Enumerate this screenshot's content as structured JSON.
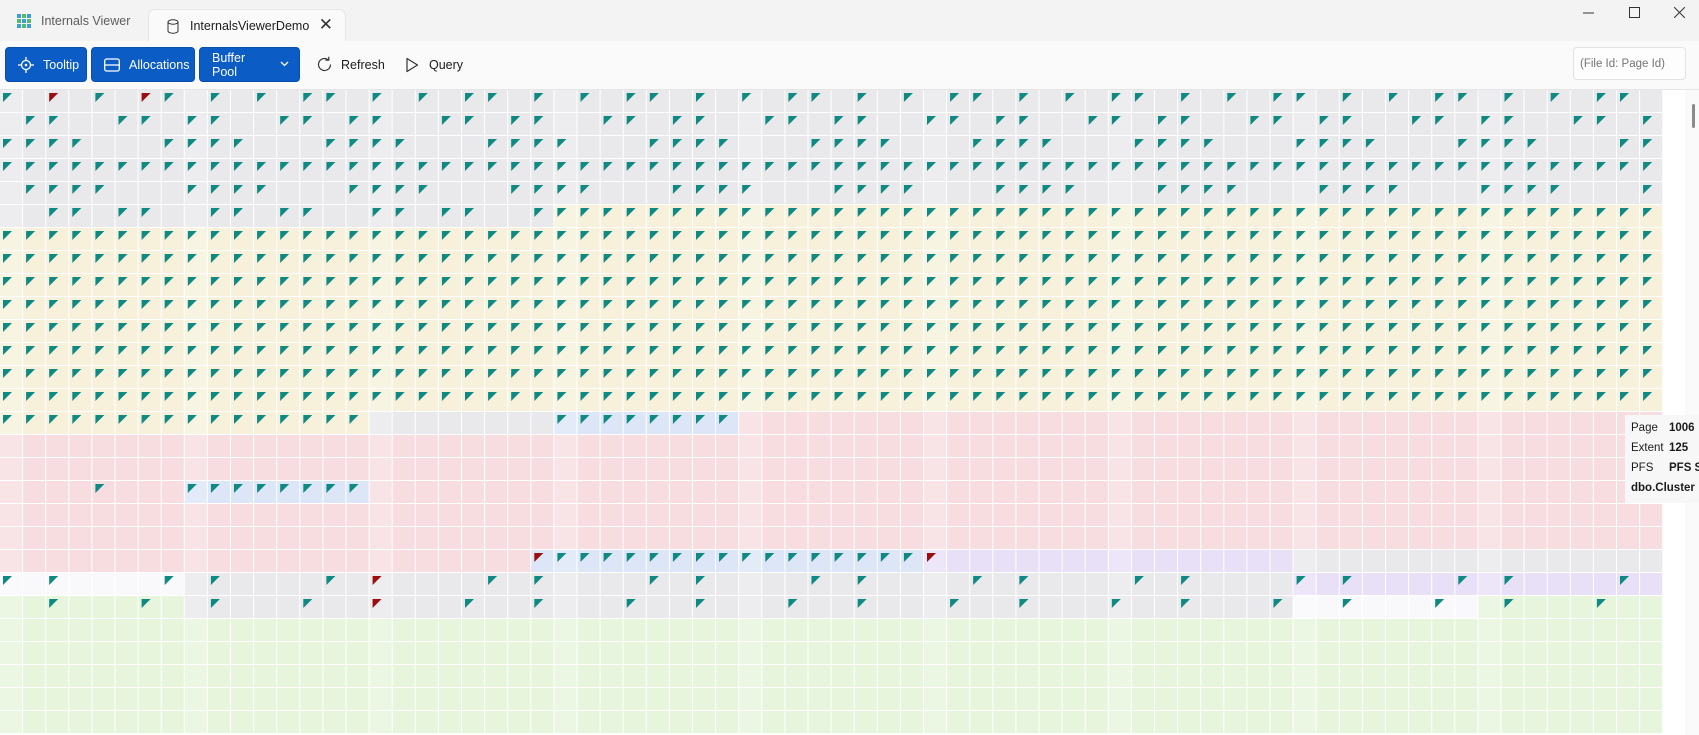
{
  "tabs": [
    {
      "label": "Internals Viewer",
      "icon": "grid-app-icon",
      "active": false
    },
    {
      "label": "InternalsViewerDemo",
      "icon": "database-icon",
      "active": true
    }
  ],
  "toolbar": {
    "tooltip_label": "Tooltip",
    "allocations_label": "Allocations",
    "buffer_pool_label": "Buffer Pool",
    "refresh_label": "Refresh",
    "query_label": "Query",
    "search_placeholder": "(File Id: Page Id)"
  },
  "colors": {
    "accent": "#0b5cc5",
    "marker_teal": "#0e8a82",
    "marker_red": "#9a0e0e",
    "fill_gray": "#e9e9ec",
    "fill_yellow": "#f7f1dc",
    "fill_pink": "#f7dde0",
    "fill_blue": "#dde6f7",
    "fill_purple": "#e8e0f6",
    "fill_green": "#e8f5dd"
  },
  "tooltip": {
    "page_label": "Page",
    "page_value": "1006",
    "extent_label": "Extent",
    "extent_value": "125",
    "pfs_label": "PFS",
    "pfs_value": "PFS S",
    "object_name": "dbo.Cluster"
  }
}
